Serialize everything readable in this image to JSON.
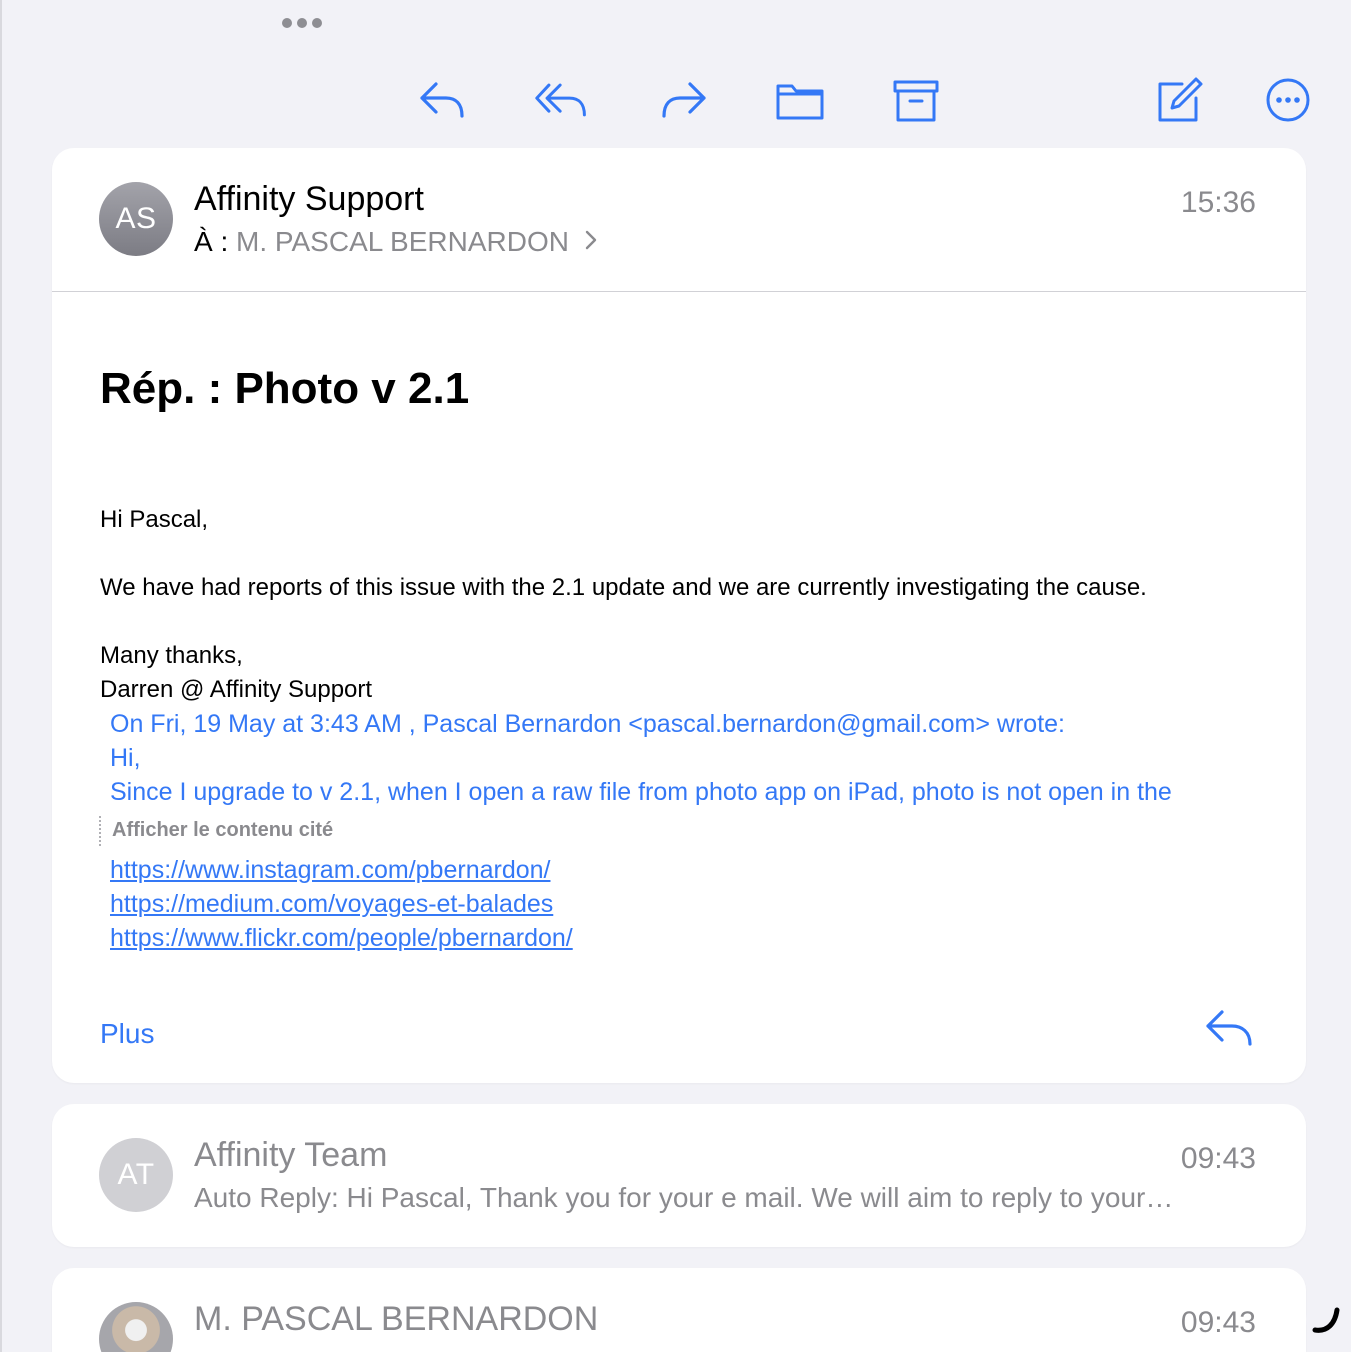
{
  "toolbar": {
    "reply_icon": "reply-arrow-icon",
    "reply_all_icon": "reply-all-icon",
    "forward_icon": "forward-arrow-icon",
    "move_icon": "folder-icon",
    "archive_icon": "archive-box-icon",
    "compose_icon": "compose-square-pencil-icon",
    "more_icon": "ellipsis-circle-icon"
  },
  "message": {
    "avatar_initials": "AS",
    "sender": "Affinity Support",
    "to_prefix": "À :",
    "recipient": "M. PASCAL BERNARDON",
    "time": "15:36",
    "subject": "Rép. : Photo v 2.1",
    "body": {
      "greeting": "Hi Pascal,",
      "line1": "We have had reports of this issue with the 2.1 update and we are currently investigating the cause.",
      "signoff": "Many thanks,",
      "signature": "Darren @ Affinity Support"
    },
    "quoted": {
      "header": "On Fri, 19 May at 3:43 AM , Pascal Bernardon <pascal.bernardon@gmail.com> wrote:",
      "line1": "Hi,",
      "line2": "Since I upgrade to v 2.1, when I open a raw file from photo app on iPad, photo is not open in the"
    },
    "show_quoted_label": "Afficher le contenu cité",
    "links": [
      "https://www.instagram.com/pbernardon/",
      "https://medium.com/voyages-et-balades",
      "https://www.flickr.com/people/pbernardon/"
    ],
    "more_label": "Plus"
  },
  "thread": [
    {
      "avatar_initials": "AT",
      "sender": "Affinity Team",
      "time": "09:43",
      "preview": "Auto Reply: Hi Pascal, Thank you for your e mail. We will aim to reply to your…"
    },
    {
      "sender": "M. PASCAL BERNARDON",
      "time": "09:43"
    }
  ],
  "colors": {
    "accent": "#3478f6",
    "secondary_text": "#8a8a8e",
    "background": "#f2f2f7"
  }
}
